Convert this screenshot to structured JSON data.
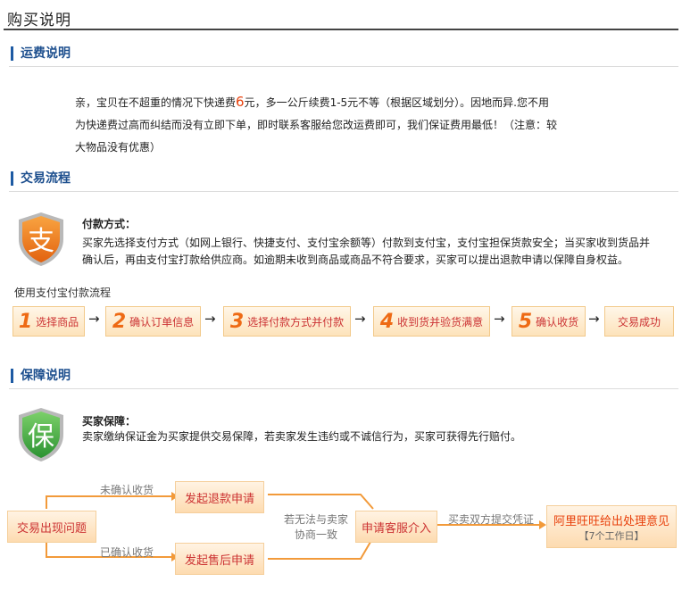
{
  "page_title": "购买说明",
  "shipping": {
    "heading": "运费说明",
    "line1_prefix": "亲，宝贝在不超重的情况下快递费",
    "fee": "6",
    "line1_suffix": "元，多一公斤续费1-5元不等（根据区域划分）。因地而异.您不用",
    "line2": "为快递费过高而纠结而没有立即下单，即时联系客服给您改运费即可，我们保证费用最低！（注意：较",
    "line3": "大物品没有优惠）"
  },
  "trade": {
    "heading": "交易流程",
    "payment_title": "付款方式：",
    "payment_line1": "买家先选择支付方式（如网上银行、快捷支付、支付宝余额等）付款到支付宝，支付宝担保货款安全；当买家收到货品并",
    "payment_line2": "确认后，再由支付宝打款给供应商。如逾期未收到商品或商品不符合要求，买家可以提出退款申请以保障自身权益。",
    "flow_caption": "使用支付宝付款流程",
    "icon_char": "支",
    "steps": [
      {
        "num": "1",
        "label": "选择商品"
      },
      {
        "num": "2",
        "label": "确认订单信息"
      },
      {
        "num": "3",
        "label": "选择付款方式并付款"
      },
      {
        "num": "4",
        "label": "收到货并验货满意"
      },
      {
        "num": "5",
        "label": "确认收货"
      },
      {
        "num": "",
        "label": "交易成功"
      }
    ],
    "arrow": "→"
  },
  "guarantee": {
    "heading": "保障说明",
    "title": "买家保障：",
    "desc": "卖家缴纳保证金为买家提供交易保障，若卖家发生违约或不诚信行为，买家可获得先行赔付。",
    "icon_char": "保",
    "flow": {
      "problem": "交易出现问题",
      "not_confirmed": "未确认收货",
      "confirmed": "已确认收货",
      "refund": "发起退款申请",
      "aftersale": "发起售后申请",
      "negotiate_line1": "若无法与卖家",
      "negotiate_line2": "协商一致",
      "service": "申请客服介入",
      "evidence": "买卖双方提交凭证",
      "result_line1": "阿里旺旺给出处理意见",
      "result_line2": "【7个工作日】"
    }
  },
  "colors": {
    "accent": "#1d5aa3",
    "orange": "#ee6a14",
    "red": "#e8410c",
    "green": "#3aa53a"
  }
}
